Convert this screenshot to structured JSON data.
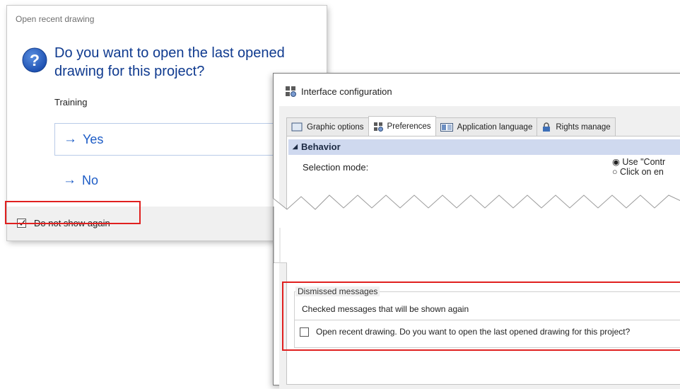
{
  "dialog": {
    "title": "Open recent drawing",
    "question": "Do you want to open the last opened drawing for this project?",
    "project": "Training",
    "commands": [
      {
        "arrow": "→",
        "label": "Yes"
      },
      {
        "arrow": "→",
        "label": "No"
      }
    ],
    "checkbox_label": "Do not show again",
    "checkbox_checked": true
  },
  "window": {
    "title": "Interface configuration",
    "tabs": [
      {
        "label": "Graphic options",
        "icon": "monitor-icon"
      },
      {
        "label": "Preferences",
        "icon": "settings-grid-icon",
        "active": true
      },
      {
        "label": "Application language",
        "icon": "language-icon"
      },
      {
        "label": "Rights manage",
        "icon": "lock-icon"
      }
    ],
    "section": {
      "label": "Behavior"
    },
    "selection_mode": {
      "label": "Selection mode:",
      "options": [
        "Use \"Contr",
        "Click on en"
      ]
    },
    "dismissed": {
      "group_title": "Dismissed messages",
      "subtitle": "Checked messages that will be shown again",
      "item": "Open recent drawing. Do you want to open the last opened drawing for this project?"
    }
  },
  "colors": {
    "highlight": "#e0201f",
    "command_text": "#1d5cc6",
    "question_text": "#0f3a8f",
    "section_bg": "#cfd9ef"
  }
}
